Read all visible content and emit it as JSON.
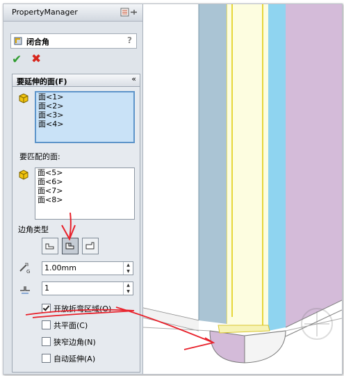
{
  "header": {
    "title": "PropertyManager"
  },
  "feature": {
    "name": "闭合角",
    "help": "?"
  },
  "actions": {
    "ok": "✔",
    "cancel": "✖"
  },
  "faces_to_extend": {
    "title": "要延伸的面(F)",
    "collapse": "«",
    "items": [
      "面<1>",
      "面<2>",
      "面<3>",
      "面<4>"
    ]
  },
  "faces_to_match": {
    "title": "要匹配的面:",
    "items": [
      "面<5>",
      "面<6>",
      "面<7>",
      "面<8>"
    ]
  },
  "corner_type": {
    "title": "边角类型",
    "selected_index": 1
  },
  "gap": {
    "value": "1.00mm"
  },
  "overlap": {
    "value": "1"
  },
  "options": [
    {
      "label": "开放折弯区域(O)",
      "checked": true
    },
    {
      "label": "共平面(C)",
      "checked": false
    },
    {
      "label": "狭窄边角(N)",
      "checked": false
    },
    {
      "label": "自动延伸(A)",
      "checked": false
    }
  ],
  "colors": {
    "annotation": "#e8202a",
    "selection": "#c9e2f7"
  }
}
